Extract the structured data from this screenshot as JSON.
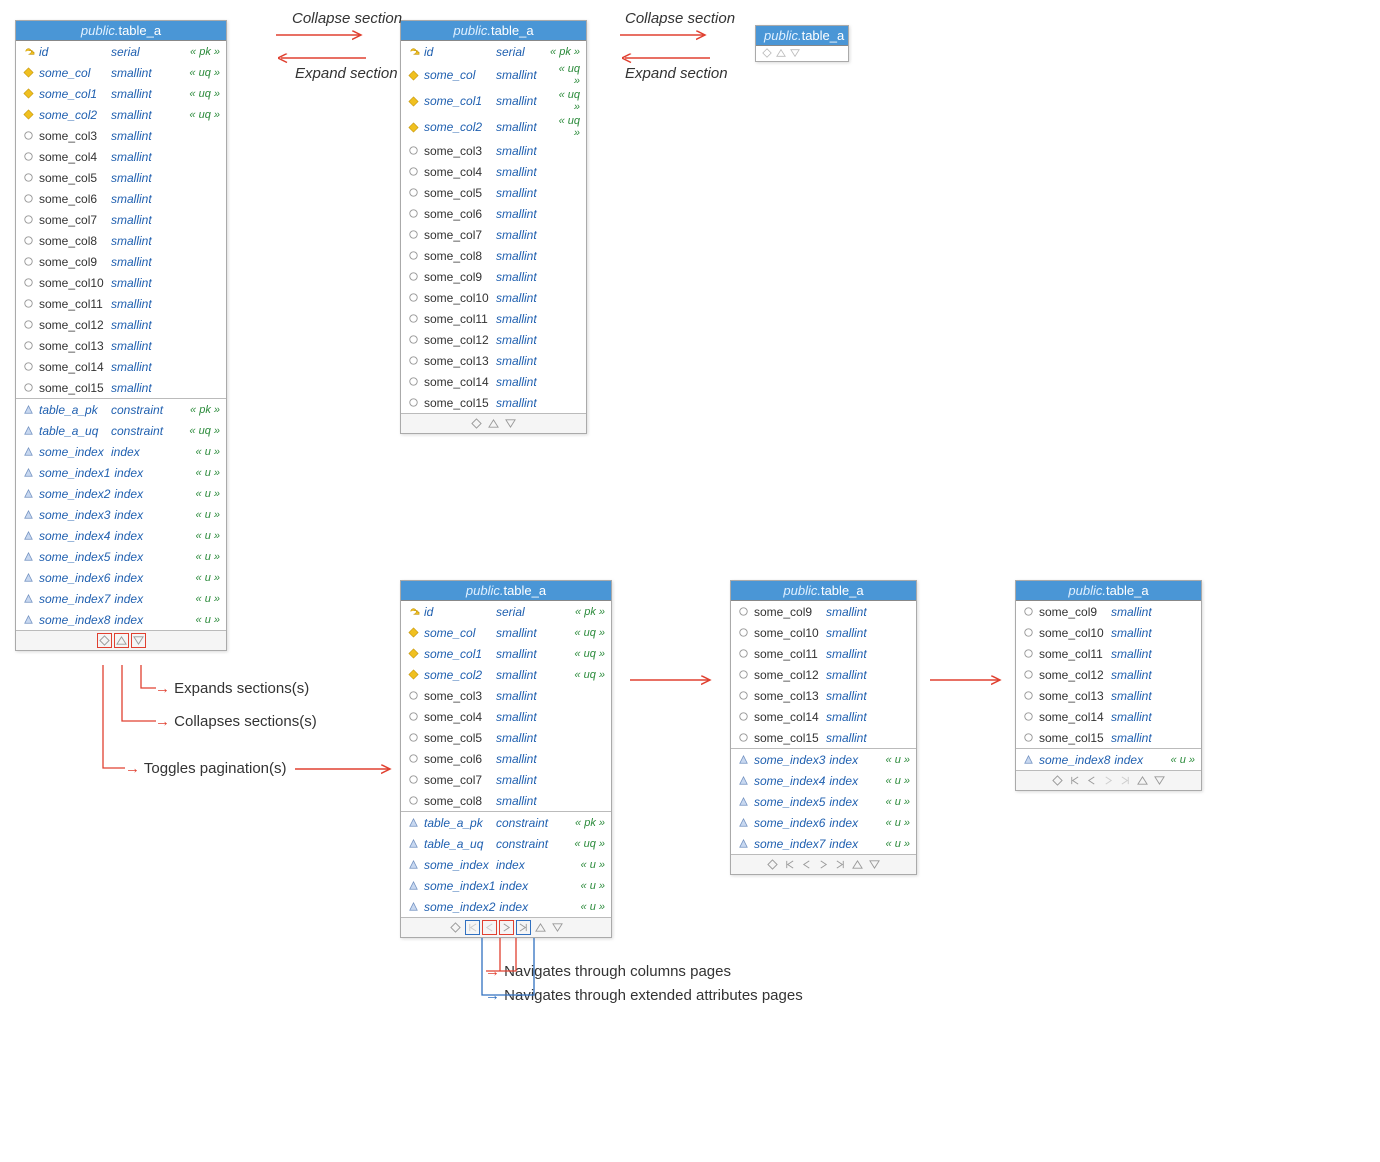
{
  "schema": "public.",
  "tname": "table_a",
  "labels": {
    "collapse": "Collapse section",
    "expand": "Expand section",
    "legend_expand": "Expands sections(s)",
    "legend_collapse": "Collapses sections(s)",
    "legend_toggle": "Toggles pagination(s)",
    "nav_cols": "Navigates through columns pages",
    "nav_attrs": "Navigates through extended attributes pages"
  },
  "cols_full": [
    {
      "n": "id",
      "t": "serial",
      "g": "« pk »",
      "i": "key",
      "em": 1
    },
    {
      "n": "some_col",
      "t": "smallint",
      "g": "« uq »",
      "i": "dia",
      "em": 1
    },
    {
      "n": "some_col1",
      "t": "smallint",
      "g": "« uq »",
      "i": "dia",
      "em": 1
    },
    {
      "n": "some_col2",
      "t": "smallint",
      "g": "« uq »",
      "i": "dia",
      "em": 1
    },
    {
      "n": "some_col3",
      "t": "smallint",
      "g": "",
      "i": "circ"
    },
    {
      "n": "some_col4",
      "t": "smallint",
      "g": "",
      "i": "circ"
    },
    {
      "n": "some_col5",
      "t": "smallint",
      "g": "",
      "i": "circ"
    },
    {
      "n": "some_col6",
      "t": "smallint",
      "g": "",
      "i": "circ"
    },
    {
      "n": "some_col7",
      "t": "smallint",
      "g": "",
      "i": "circ"
    },
    {
      "n": "some_col8",
      "t": "smallint",
      "g": "",
      "i": "circ"
    },
    {
      "n": "some_col9",
      "t": "smallint",
      "g": "",
      "i": "circ"
    },
    {
      "n": "some_col10",
      "t": "smallint",
      "g": "",
      "i": "circ"
    },
    {
      "n": "some_col11",
      "t": "smallint",
      "g": "",
      "i": "circ"
    },
    {
      "n": "some_col12",
      "t": "smallint",
      "g": "",
      "i": "circ"
    },
    {
      "n": "some_col13",
      "t": "smallint",
      "g": "",
      "i": "circ"
    },
    {
      "n": "some_col14",
      "t": "smallint",
      "g": "",
      "i": "circ"
    },
    {
      "n": "some_col15",
      "t": "smallint",
      "g": "",
      "i": "circ"
    }
  ],
  "attrs_full": [
    {
      "n": "table_a_pk",
      "t": "constraint",
      "g": "« pk »",
      "i": "tri",
      "em": 1
    },
    {
      "n": "table_a_uq",
      "t": "constraint",
      "g": "« uq »",
      "i": "tri",
      "em": 1
    },
    {
      "n": "some_index",
      "t": "index",
      "g": "« u »",
      "i": "tri",
      "em": 1
    },
    {
      "n": "some_index1",
      "t": "index",
      "g": "« u »",
      "i": "tri",
      "em": 1
    },
    {
      "n": "some_index2",
      "t": "index",
      "g": "« u »",
      "i": "tri",
      "em": 1
    },
    {
      "n": "some_index3",
      "t": "index",
      "g": "« u »",
      "i": "tri",
      "em": 1
    },
    {
      "n": "some_index4",
      "t": "index",
      "g": "« u »",
      "i": "tri",
      "em": 1
    },
    {
      "n": "some_index5",
      "t": "index",
      "g": "« u »",
      "i": "tri",
      "em": 1
    },
    {
      "n": "some_index6",
      "t": "index",
      "g": "« u »",
      "i": "tri",
      "em": 1
    },
    {
      "n": "some_index7",
      "t": "index",
      "g": "« u »",
      "i": "tri",
      "em": 1
    },
    {
      "n": "some_index8",
      "t": "index",
      "g": "« u »",
      "i": "tri",
      "em": 1
    }
  ],
  "paged_cols_1": [
    {
      "n": "id",
      "t": "serial",
      "g": "« pk »",
      "i": "key",
      "em": 1
    },
    {
      "n": "some_col",
      "t": "smallint",
      "g": "« uq »",
      "i": "dia",
      "em": 1
    },
    {
      "n": "some_col1",
      "t": "smallint",
      "g": "« uq »",
      "i": "dia",
      "em": 1
    },
    {
      "n": "some_col2",
      "t": "smallint",
      "g": "« uq »",
      "i": "dia",
      "em": 1
    },
    {
      "n": "some_col3",
      "t": "smallint",
      "g": "",
      "i": "circ"
    },
    {
      "n": "some_col4",
      "t": "smallint",
      "g": "",
      "i": "circ"
    },
    {
      "n": "some_col5",
      "t": "smallint",
      "g": "",
      "i": "circ"
    },
    {
      "n": "some_col6",
      "t": "smallint",
      "g": "",
      "i": "circ"
    },
    {
      "n": "some_col7",
      "t": "smallint",
      "g": "",
      "i": "circ"
    },
    {
      "n": "some_col8",
      "t": "smallint",
      "g": "",
      "i": "circ"
    }
  ],
  "paged_attrs_1": [
    {
      "n": "table_a_pk",
      "t": "constraint",
      "g": "« pk »",
      "i": "tri",
      "em": 1
    },
    {
      "n": "table_a_uq",
      "t": "constraint",
      "g": "« uq »",
      "i": "tri",
      "em": 1
    },
    {
      "n": "some_index",
      "t": "index",
      "g": "« u »",
      "i": "tri",
      "em": 1
    },
    {
      "n": "some_index1",
      "t": "index",
      "g": "« u »",
      "i": "tri",
      "em": 1
    },
    {
      "n": "some_index2",
      "t": "index",
      "g": "« u »",
      "i": "tri",
      "em": 1
    }
  ],
  "paged_cols_2": [
    {
      "n": "some_col9",
      "t": "smallint",
      "g": "",
      "i": "circ"
    },
    {
      "n": "some_col10",
      "t": "smallint",
      "g": "",
      "i": "circ"
    },
    {
      "n": "some_col11",
      "t": "smallint",
      "g": "",
      "i": "circ"
    },
    {
      "n": "some_col12",
      "t": "smallint",
      "g": "",
      "i": "circ"
    },
    {
      "n": "some_col13",
      "t": "smallint",
      "g": "",
      "i": "circ"
    },
    {
      "n": "some_col14",
      "t": "smallint",
      "g": "",
      "i": "circ"
    },
    {
      "n": "some_col15",
      "t": "smallint",
      "g": "",
      "i": "circ"
    }
  ],
  "paged_attrs_2": [
    {
      "n": "some_index3",
      "t": "index",
      "g": "« u »",
      "i": "tri",
      "em": 1
    },
    {
      "n": "some_index4",
      "t": "index",
      "g": "« u »",
      "i": "tri",
      "em": 1
    },
    {
      "n": "some_index5",
      "t": "index",
      "g": "« u »",
      "i": "tri",
      "em": 1
    },
    {
      "n": "some_index6",
      "t": "index",
      "g": "« u »",
      "i": "tri",
      "em": 1
    },
    {
      "n": "some_index7",
      "t": "index",
      "g": "« u »",
      "i": "tri",
      "em": 1
    }
  ],
  "paged_cols_3": [
    {
      "n": "some_col9",
      "t": "smallint",
      "g": "",
      "i": "circ"
    },
    {
      "n": "some_col10",
      "t": "smallint",
      "g": "",
      "i": "circ"
    },
    {
      "n": "some_col11",
      "t": "smallint",
      "g": "",
      "i": "circ"
    },
    {
      "n": "some_col12",
      "t": "smallint",
      "g": "",
      "i": "circ"
    },
    {
      "n": "some_col13",
      "t": "smallint",
      "g": "",
      "i": "circ"
    },
    {
      "n": "some_col14",
      "t": "smallint",
      "g": "",
      "i": "circ"
    },
    {
      "n": "some_col15",
      "t": "smallint",
      "g": "",
      "i": "circ"
    }
  ],
  "paged_attrs_3": [
    {
      "n": "some_index8",
      "t": "index",
      "g": "« u »",
      "i": "tri",
      "em": 1
    }
  ]
}
